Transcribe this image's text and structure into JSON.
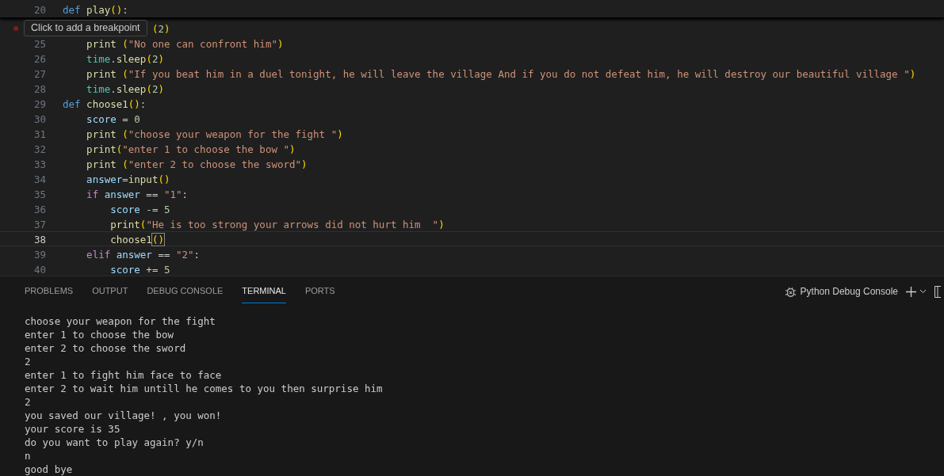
{
  "editor": {
    "sticky_line": {
      "number": "20",
      "tokens": [
        {
          "kind": "kw",
          "text": "def "
        },
        {
          "kind": "fn",
          "text": "play"
        },
        {
          "kind": "br",
          "text": "()"
        },
        {
          "kind": "op",
          "text": ":"
        }
      ]
    },
    "lines": [
      {
        "covered": true,
        "current": false,
        "tokens": [
          {
            "kind": "br",
            "text": "("
          },
          {
            "kind": "num",
            "text": "2"
          },
          {
            "kind": "br",
            "text": ")"
          }
        ]
      },
      {
        "number": "25",
        "covered": false,
        "current": false,
        "tokens": [
          {
            "kind": "fn",
            "text": "    print"
          },
          {
            "kind": "br",
            "text": " ("
          },
          {
            "kind": "str",
            "text": "\"No one can confront him\""
          },
          {
            "kind": "br",
            "text": ")"
          }
        ]
      },
      {
        "number": "26",
        "covered": false,
        "current": false,
        "tokens": [
          {
            "kind": "mod",
            "text": "    time"
          },
          {
            "kind": "op",
            "text": "."
          },
          {
            "kind": "fn",
            "text": "sleep"
          },
          {
            "kind": "br",
            "text": "("
          },
          {
            "kind": "num",
            "text": "2"
          },
          {
            "kind": "br",
            "text": ")"
          }
        ]
      },
      {
        "number": "27",
        "covered": false,
        "current": false,
        "tokens": [
          {
            "kind": "fn",
            "text": "    print"
          },
          {
            "kind": "br",
            "text": " ("
          },
          {
            "kind": "str",
            "text": "\"If you beat him in a duel tonight, he will leave the village And if you do not defeat him, he will destroy our beautiful village \""
          },
          {
            "kind": "br",
            "text": ")"
          }
        ]
      },
      {
        "number": "28",
        "covered": false,
        "current": false,
        "tokens": [
          {
            "kind": "mod",
            "text": "    time"
          },
          {
            "kind": "op",
            "text": "."
          },
          {
            "kind": "fn",
            "text": "sleep"
          },
          {
            "kind": "br",
            "text": "("
          },
          {
            "kind": "num",
            "text": "2"
          },
          {
            "kind": "br",
            "text": ")"
          }
        ]
      },
      {
        "number": "29",
        "covered": false,
        "current": false,
        "tokens": [
          {
            "kind": "kw",
            "text": "def "
          },
          {
            "kind": "fn",
            "text": "choose1"
          },
          {
            "kind": "br",
            "text": "()"
          },
          {
            "kind": "op",
            "text": ":"
          }
        ]
      },
      {
        "number": "30",
        "covered": false,
        "current": false,
        "tokens": [
          {
            "kind": "var",
            "text": "    score"
          },
          {
            "kind": "op",
            "text": " = "
          },
          {
            "kind": "num",
            "text": "0"
          }
        ]
      },
      {
        "number": "31",
        "covered": false,
        "current": false,
        "tokens": [
          {
            "kind": "fn",
            "text": "    print"
          },
          {
            "kind": "br",
            "text": " ("
          },
          {
            "kind": "str",
            "text": "\"choose your weapon for the fight \""
          },
          {
            "kind": "br",
            "text": ")"
          }
        ]
      },
      {
        "number": "32",
        "covered": false,
        "current": false,
        "tokens": [
          {
            "kind": "fn",
            "text": "    print"
          },
          {
            "kind": "br",
            "text": "("
          },
          {
            "kind": "str",
            "text": "\"enter 1 to choose the bow \""
          },
          {
            "kind": "br",
            "text": ")"
          }
        ]
      },
      {
        "number": "33",
        "covered": false,
        "current": false,
        "tokens": [
          {
            "kind": "fn",
            "text": "    print"
          },
          {
            "kind": "br",
            "text": " ("
          },
          {
            "kind": "str",
            "text": "\"enter 2 to choose the sword\""
          },
          {
            "kind": "br",
            "text": ")"
          }
        ]
      },
      {
        "number": "34",
        "covered": false,
        "current": false,
        "tokens": [
          {
            "kind": "var",
            "text": "    answer"
          },
          {
            "kind": "op",
            "text": "="
          },
          {
            "kind": "fn",
            "text": "input"
          },
          {
            "kind": "br",
            "text": "()"
          }
        ]
      },
      {
        "number": "35",
        "covered": false,
        "current": false,
        "tokens": [
          {
            "kind": "ctl",
            "text": "    if "
          },
          {
            "kind": "var",
            "text": "answer"
          },
          {
            "kind": "op",
            "text": " == "
          },
          {
            "kind": "str",
            "text": "\"1\""
          },
          {
            "kind": "op",
            "text": ":"
          }
        ]
      },
      {
        "number": "36",
        "covered": false,
        "current": false,
        "tokens": [
          {
            "kind": "var",
            "text": "        score"
          },
          {
            "kind": "op",
            "text": " -= "
          },
          {
            "kind": "num",
            "text": "5"
          }
        ]
      },
      {
        "number": "37",
        "covered": false,
        "current": false,
        "tokens": [
          {
            "kind": "fn",
            "text": "        print"
          },
          {
            "kind": "br",
            "text": "("
          },
          {
            "kind": "str",
            "text": "\"He is too strong your arrows did not hurt him  \""
          },
          {
            "kind": "br",
            "text": ")"
          }
        ]
      },
      {
        "number": "38",
        "covered": false,
        "current": true,
        "tokens": [
          {
            "kind": "fn",
            "text": "        choose1"
          },
          {
            "kind": "brm",
            "text": "()"
          }
        ]
      },
      {
        "number": "39",
        "covered": false,
        "current": false,
        "tokens": [
          {
            "kind": "ctl",
            "text": "    elif "
          },
          {
            "kind": "var",
            "text": "answer"
          },
          {
            "kind": "op",
            "text": " == "
          },
          {
            "kind": "str",
            "text": "\"2\""
          },
          {
            "kind": "op",
            "text": ":"
          }
        ]
      },
      {
        "number": "40",
        "covered": false,
        "current": false,
        "tokens": [
          {
            "kind": "var",
            "text": "        score"
          },
          {
            "kind": "op",
            "text": " += "
          },
          {
            "kind": "num",
            "text": "5"
          }
        ]
      }
    ],
    "tooltip": "Click to add a breakpoint"
  },
  "panel": {
    "tabs": [
      {
        "label": "PROBLEMS",
        "selected": false
      },
      {
        "label": "OUTPUT",
        "selected": false
      },
      {
        "label": "DEBUG CONSOLE",
        "selected": false
      },
      {
        "label": "TERMINAL",
        "selected": true
      },
      {
        "label": "PORTS",
        "selected": false
      }
    ],
    "terminal_name": "Python Debug Console",
    "terminal_lines": [
      "choose your weapon for the fight",
      "enter 1 to choose the bow",
      "enter 2 to choose the sword",
      "2",
      "enter 1 to fight him face to face",
      "enter 2 to wait him untill he comes to you then surprise him",
      "2",
      "you saved our village! , you won!",
      "your score is 35",
      "do you want to play again? y/n",
      "n",
      "good bye"
    ]
  }
}
